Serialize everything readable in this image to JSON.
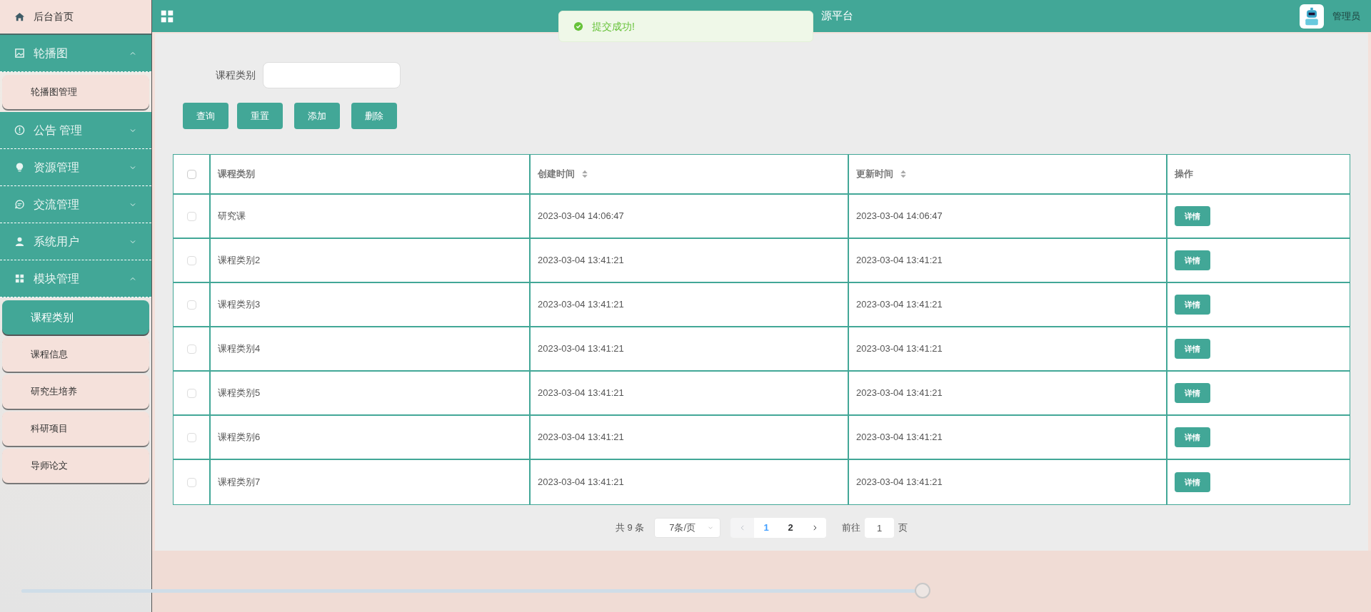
{
  "header": {
    "title": "源平台",
    "user": "管理员"
  },
  "toast": {
    "kind": "success",
    "message": "提交成功!"
  },
  "sidebar": {
    "items": [
      {
        "kind": "link",
        "label": "后台首页"
      },
      {
        "kind": "group",
        "label": "轮播图",
        "expanded": true,
        "children": [
          {
            "label": "轮播图管理",
            "selected": false
          }
        ]
      },
      {
        "kind": "group",
        "label": "公告 管理",
        "expanded": false
      },
      {
        "kind": "group",
        "label": "资源管理",
        "expanded": false
      },
      {
        "kind": "group",
        "label": "交流管理",
        "expanded": false
      },
      {
        "kind": "group",
        "label": "系统用户",
        "expanded": false
      },
      {
        "kind": "group",
        "label": "模块管理",
        "expanded": true,
        "children": [
          {
            "label": "课程类别",
            "selected": true
          },
          {
            "label": "课程信息",
            "selected": false
          },
          {
            "label": "研究生培养",
            "selected": false
          },
          {
            "label": "科研项目",
            "selected": false
          },
          {
            "label": "导师论文",
            "selected": false
          }
        ]
      }
    ]
  },
  "search": {
    "label": "课程类别"
  },
  "buttons": [
    "查询",
    "重置",
    "添加",
    "删除"
  ],
  "table": {
    "select_all": {
      "checked": false
    },
    "columns": [
      {
        "label": "课程类别",
        "sortable": false
      },
      {
        "label": "创建时间",
        "sortable": true
      },
      {
        "label": "更新时间",
        "sortable": true
      },
      {
        "label": "操作",
        "sortable": false
      }
    ],
    "rows": [
      {
        "checked": false,
        "cells": [
          "研究课",
          "2023-03-04 14:06:47",
          "2023-03-04 14:06:47"
        ],
        "action": "详情"
      },
      {
        "checked": false,
        "cells": [
          "课程类别2",
          "2023-03-04 13:41:21",
          "2023-03-04 13:41:21"
        ],
        "action": "详情"
      },
      {
        "checked": false,
        "cells": [
          "课程类别3",
          "2023-03-04 13:41:21",
          "2023-03-04 13:41:21"
        ],
        "action": "详情"
      },
      {
        "checked": false,
        "cells": [
          "课程类别4",
          "2023-03-04 13:41:21",
          "2023-03-04 13:41:21"
        ],
        "action": "详情"
      },
      {
        "checked": false,
        "cells": [
          "课程类别5",
          "2023-03-04 13:41:21",
          "2023-03-04 13:41:21"
        ],
        "action": "详情"
      },
      {
        "checked": false,
        "cells": [
          "课程类别6",
          "2023-03-04 13:41:21",
          "2023-03-04 13:41:21"
        ],
        "action": "详情"
      },
      {
        "checked": false,
        "cells": [
          "课程类别7",
          "2023-03-04 13:41:21",
          "2023-03-04 13:41:21"
        ],
        "action": "详情"
      }
    ]
  },
  "pagination": {
    "total": "共 9 条",
    "page_size": "7条/页",
    "pages": [
      {
        "label": "1",
        "selected": true
      },
      {
        "label": "2",
        "selected": false
      }
    ],
    "goto_label": "前往",
    "goto_value": "1",
    "goto_suffix": "页"
  },
  "slider": {
    "level": 1
  }
}
